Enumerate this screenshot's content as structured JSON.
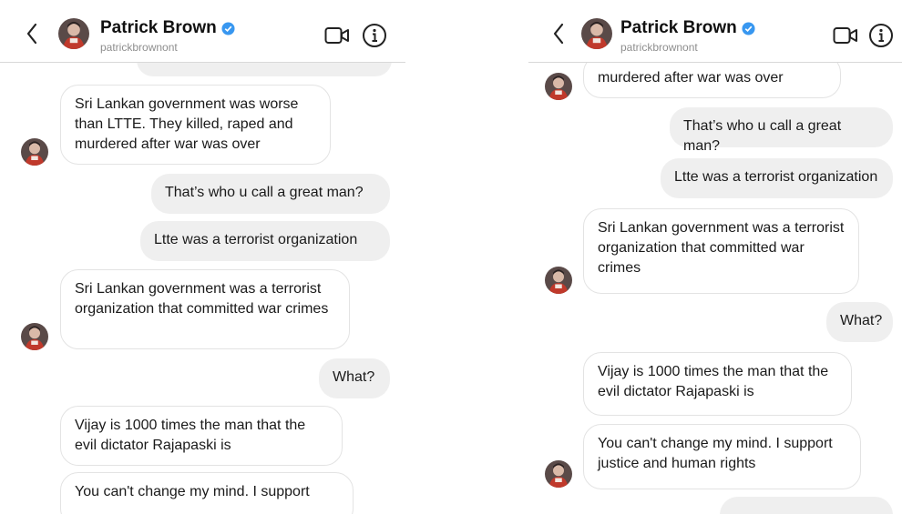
{
  "contact": {
    "name": "Patrick Brown",
    "username": "patrickbrownont",
    "verified": true,
    "verified_color": "#3897f0"
  },
  "icons": [
    "chevron-left-icon",
    "verified-badge-icon",
    "video-call-icon",
    "info-icon"
  ],
  "colors": {
    "incoming_bubble_bg": "#ffffff",
    "incoming_bubble_border": "#e3e3e3",
    "outgoing_bubble_bg": "#efefef",
    "username": "#8e8e8e"
  },
  "left_panel": {
    "messages": [
      {
        "dir": "in",
        "text": "Sri Lankan government was worse than LTTE. They killed, raped and murdered after war was over"
      },
      {
        "dir": "out",
        "text": "That’s who u call a great man?"
      },
      {
        "dir": "out",
        "text": "Ltte was a terrorist organization"
      },
      {
        "dir": "in",
        "text": "Sri Lankan government was a terrorist organization that committed war crimes"
      },
      {
        "dir": "out",
        "text": "What?"
      },
      {
        "dir": "in",
        "text": "Vijay is 1000 times the man that the evil dictator Rajapaski is"
      },
      {
        "dir": "in",
        "text": "You can't change my mind.  I support"
      }
    ]
  },
  "right_panel": {
    "messages": [
      {
        "dir": "in",
        "text": "murdered after war was over"
      },
      {
        "dir": "out",
        "text": "That’s who u call a great man?"
      },
      {
        "dir": "out",
        "text": "Ltte was a terrorist organization"
      },
      {
        "dir": "in",
        "text": "Sri Lankan government was a terrorist organization that committed war crimes"
      },
      {
        "dir": "out",
        "text": "What?"
      },
      {
        "dir": "in",
        "text": "Vijay is 1000 times the man that the evil dictator Rajapaski is"
      },
      {
        "dir": "in",
        "text": "You can't change my mind.  I support justice and human rights"
      }
    ]
  }
}
